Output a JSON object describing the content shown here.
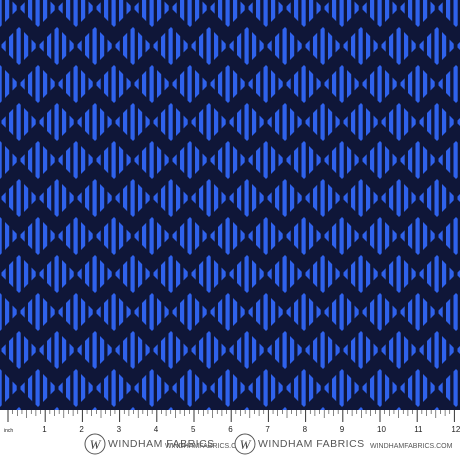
{
  "swatch": {
    "colors": {
      "background": "#0f1638",
      "stripe": "#2f62ec",
      "ruler": "#ffffff",
      "ruler_ink": "#222222"
    },
    "pattern": "diamond-checker-with-vertical-stripes"
  },
  "ruler": {
    "unit_label": "inch",
    "numbers": [
      "1",
      "2",
      "3",
      "4",
      "5",
      "6",
      "7",
      "8",
      "9",
      "10",
      "11",
      "12"
    ],
    "logo_icon": "windham-w-logo-icon",
    "brand_name": "WINDHAM FABRICS",
    "website": "WINDHAMFABRICS.COM"
  }
}
